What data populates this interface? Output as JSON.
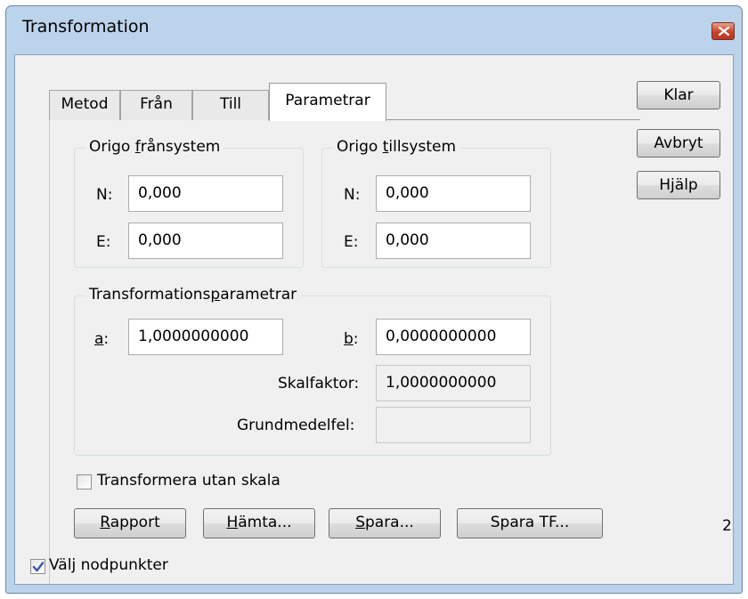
{
  "window": {
    "title": "Transformation"
  },
  "tabs": [
    {
      "label": "Metod"
    },
    {
      "label": "Från"
    },
    {
      "label": "Till"
    },
    {
      "label": "Parametrar"
    }
  ],
  "origin_from": {
    "label_pre": "Origo ",
    "label_u": "f",
    "label_post": "rånsystem",
    "n_label": "N:",
    "n_value": "0,000",
    "e_label": "E:",
    "e_value": "0,000"
  },
  "origin_to": {
    "label_pre": "Origo ",
    "label_u": "t",
    "label_post": "illsystem",
    "n_label": "N:",
    "n_value": "0,000",
    "e_label": "E:",
    "e_value": "0,000"
  },
  "params": {
    "label_pre": "Transformations",
    "label_u": "p",
    "label_post": "arametrar",
    "a_u": "a",
    "a_colon": ":",
    "a_value": "1,0000000000",
    "b_u": "b",
    "b_colon": ":",
    "b_value": "0,0000000000",
    "scale_label": "Skalfaktor:",
    "scale_value": "1,0000000000",
    "error_label": "Grundmedelfel:",
    "error_value": ""
  },
  "side_buttons": {
    "ok": "Klar",
    "cancel": "Avbryt",
    "help": "Hjälp"
  },
  "options": {
    "no_scale_label": "Transformera utan skala",
    "no_scale_checked": false,
    "select_nodes_label": "Välj nodpunkter",
    "select_nodes_checked": true
  },
  "bottom_buttons": {
    "report_u": "R",
    "report_rest": "apport",
    "fetch_u": "H",
    "fetch_rest": "ämta...",
    "save_u": "S",
    "save_rest": "para...",
    "save_tf": "Spara TF..."
  },
  "page_number": "2",
  "colors": {
    "title_bar": "#bcd3ec",
    "dialog_bg": "#f0f0f0",
    "close_button": "#c6442c"
  }
}
